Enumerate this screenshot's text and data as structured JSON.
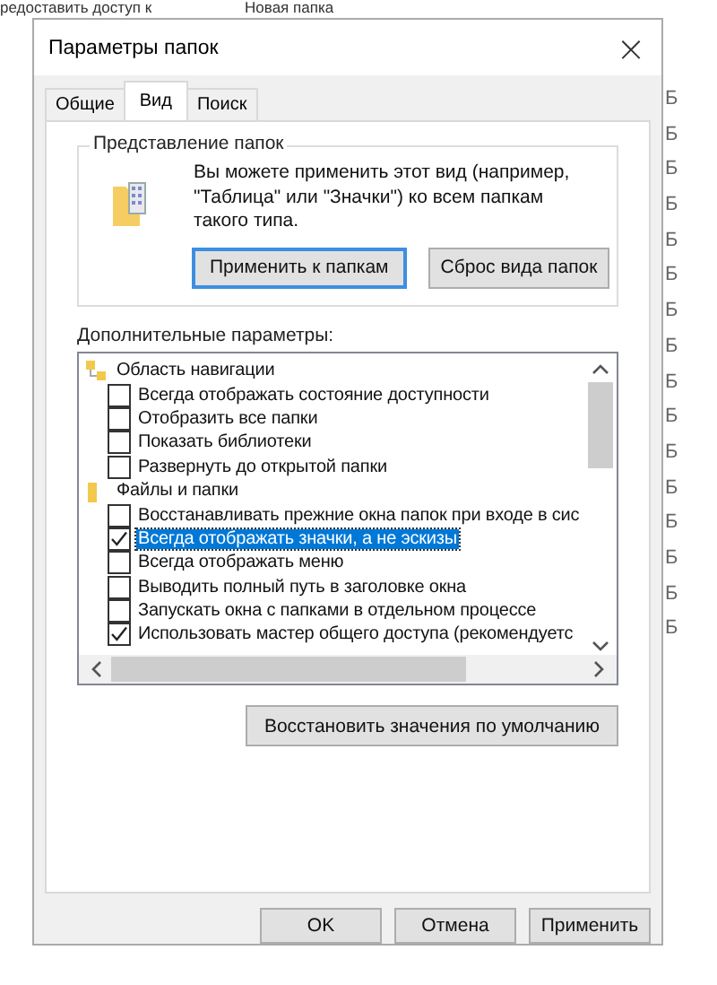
{
  "background": {
    "toolbar_items": [
      "редоставить доступ к",
      "Новая папка"
    ],
    "column_values": [
      "Б",
      "Б",
      "Б",
      "Б",
      "Б",
      "Б",
      "Б",
      "Б",
      "Б",
      "Б",
      "Б",
      "Б",
      "Б",
      "Б",
      "Б",
      "Б"
    ]
  },
  "window": {
    "title": "Параметры папок",
    "close": "×"
  },
  "tabs": [
    {
      "label": "Общие",
      "selected": false
    },
    {
      "label": "Вид",
      "selected": true
    },
    {
      "label": "Поиск",
      "selected": false
    }
  ],
  "folder_views": {
    "title": "Представление папок",
    "description": "Вы можете применить этот вид (например, \"Таблица\" или \"Значки\") ко всем папкам такого типа.",
    "buttons": [
      {
        "label": "Применить к папкам",
        "focused": true
      },
      {
        "label": "Сброс вида папок",
        "focused": false
      }
    ]
  },
  "advanced": {
    "label": "Дополнительные параметры:",
    "items": [
      {
        "kind": "group",
        "label": "Область навигации",
        "children": [
          {
            "kind": "checkbox",
            "label": "Всегда отображать состояние доступности",
            "checked": false,
            "selected": false
          },
          {
            "kind": "checkbox",
            "label": "Отобразить все папки",
            "checked": false,
            "selected": false
          },
          {
            "kind": "checkbox",
            "label": "Показать библиотеки",
            "checked": false,
            "selected": false
          },
          {
            "kind": "checkbox",
            "label": "Развернуть до открытой папки",
            "checked": false,
            "selected": false
          }
        ]
      },
      {
        "kind": "group",
        "label": "Файлы и папки",
        "children": [
          {
            "kind": "checkbox",
            "label": "Восстанавливать прежние окна папок при входе в сис",
            "checked": false,
            "selected": false
          },
          {
            "kind": "checkbox",
            "label": "Всегда отображать значки, а не эскизы",
            "checked": true,
            "selected": true
          },
          {
            "kind": "checkbox",
            "label": "Всегда отображать меню",
            "checked": false,
            "selected": false
          },
          {
            "kind": "checkbox",
            "label": "Выводить полный путь в заголовке окна",
            "checked": false,
            "selected": false
          },
          {
            "kind": "checkbox",
            "label": "Запускать окна с папками в отдельном процессе",
            "checked": false,
            "selected": false
          },
          {
            "kind": "checkbox",
            "label": "Использовать мастер общего доступа (рекомендуетс",
            "checked": true,
            "selected": false
          }
        ]
      }
    ],
    "restore_button": "Восстановить значения по умолчанию"
  },
  "buttons": [
    {
      "label": "OK",
      "disabled": false
    },
    {
      "label": "Отмена",
      "disabled": false
    },
    {
      "label": "Применить",
      "disabled": false
    }
  ]
}
